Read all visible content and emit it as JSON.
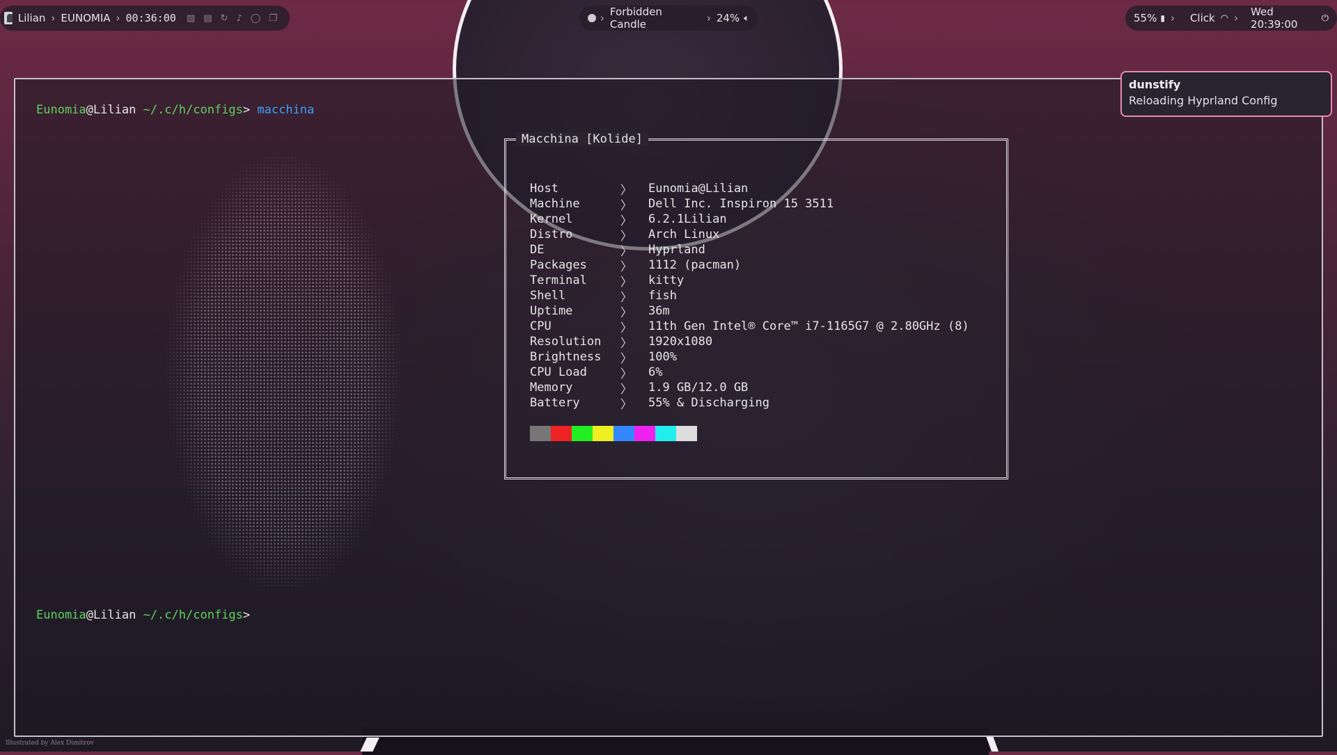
{
  "topbar": {
    "left": {
      "user": "Lilian",
      "host": "EUNOMIA",
      "uptime": "00:36:00",
      "icons": [
        "image-icon",
        "save-icon",
        "refresh-icon",
        "music-icon",
        "chat-icon",
        "window-icon"
      ]
    },
    "center": {
      "track": "Forbidden Candle",
      "volume": "24%"
    },
    "right": {
      "battery": "55%",
      "network": "Click",
      "datetime": "Wed 20:39:00"
    }
  },
  "terminal": {
    "prompt1": {
      "user": "Eunomia",
      "at": "@",
      "host": "Lilian",
      "path": "~/.c/h/configs",
      "symbol": ">",
      "command": "macchina"
    },
    "prompt2": {
      "user": "Eunomia",
      "at": "@",
      "host": "Lilian",
      "path": "~/.c/h/configs",
      "symbol": ">"
    },
    "macchina": {
      "title": "Macchina [Kolide]",
      "rows": [
        {
          "key": "Host",
          "value": "Eunomia@Lilian"
        },
        {
          "key": "Machine",
          "value": "Dell Inc. Inspiron 15 3511"
        },
        {
          "key": "Kernel",
          "value": "6.2.1Lilian"
        },
        {
          "key": "Distro",
          "value": "Arch Linux"
        },
        {
          "key": "DE",
          "value": "Hyprland"
        },
        {
          "key": "Packages",
          "value": "1112 (pacman)"
        },
        {
          "key": "Terminal",
          "value": "kitty"
        },
        {
          "key": "Shell",
          "value": "fish"
        },
        {
          "key": "Uptime",
          "value": "36m"
        },
        {
          "key": "CPU",
          "value": "11th Gen Intel® Core™ i7-1165G7 @ 2.80GHz (8)"
        },
        {
          "key": "Resolution",
          "value": "1920x1080"
        },
        {
          "key": "Brightness",
          "value": "100%"
        },
        {
          "key": "CPU Load",
          "value": "6%"
        },
        {
          "key": "Memory",
          "value": "1.9 GB/12.0 GB"
        },
        {
          "key": "Battery",
          "value": "55% & Discharging"
        }
      ],
      "palette": [
        "#777777",
        "#ee2222",
        "#22ee22",
        "#eeee22",
        "#3388ff",
        "#ee22ee",
        "#22eeee",
        "#dddddd"
      ]
    }
  },
  "notification": {
    "app": "dunstify",
    "body": "Reloading Hyprland Config"
  },
  "credit": "Illustrated by Alex Dimitrov"
}
